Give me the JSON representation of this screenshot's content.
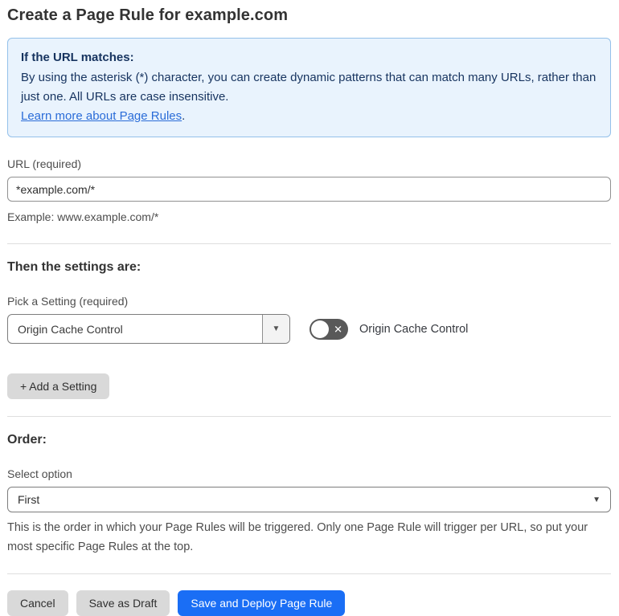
{
  "page": {
    "title": "Create a Page Rule for example.com"
  },
  "info_box": {
    "heading": "If the URL matches:",
    "body": "By using the asterisk (*) character, you can create dynamic patterns that can match many URLs, rather than just one. All URLs are case insensitive.",
    "link_label": "Learn more about Page Rules",
    "link_suffix": "."
  },
  "url_field": {
    "label": "URL (required)",
    "value": "*example.com/*",
    "helper": "Example: www.example.com/*"
  },
  "settings_section": {
    "heading": "Then the settings are:",
    "picker_label": "Pick a Setting (required)",
    "picker_value": "Origin Cache Control",
    "toggle_label": "Origin Cache Control",
    "toggle_state": "off",
    "add_setting_label": "+ Add a Setting"
  },
  "order_section": {
    "heading": "Order:",
    "select_label": "Select option",
    "select_value": "First",
    "helper": "This is the order in which your Page Rules will be triggered. Only one Page Rule will trigger per URL, so put your most specific Page Rules at the top."
  },
  "footer": {
    "cancel_label": "Cancel",
    "save_draft_label": "Save as Draft",
    "save_deploy_label": "Save and Deploy Page Rule"
  },
  "icons": {
    "dropdown_arrow": "▼",
    "toggle_x": "✕"
  },
  "colors": {
    "accent_blue": "#1a6ef5",
    "info_box_bg": "#e9f3fd",
    "info_box_border": "#94c1ea",
    "info_text": "#16335f",
    "link_blue": "#2a6cd8",
    "toggle_off_bg": "#595959",
    "gray_button_bg": "#d9d9d9"
  }
}
